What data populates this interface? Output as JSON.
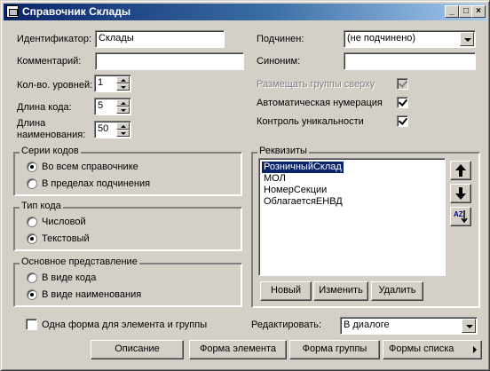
{
  "window": {
    "title": "Справочник Склады",
    "minimize": "_",
    "maximize": "□",
    "close": "×"
  },
  "left": {
    "id_label": "Идентификатор:",
    "id_value": "Склады",
    "comment_label": "Комментарий:",
    "comment_value": "",
    "levels_label": "Кол-во. уровней:",
    "levels_value": "1",
    "code_len_label": "Длина кода:",
    "code_len_value": "5",
    "name_len_label_1": "Длина",
    "name_len_label_2": "наименования:",
    "name_len_value": "50"
  },
  "right": {
    "parent_label": "Подчинен:",
    "parent_value": "(не подчинено)",
    "synonym_label": "Синоним:",
    "synonym_value": "",
    "groups_top_label": "Размещать группы сверху",
    "groups_top_checked": true,
    "auto_num_label": "Автоматическая нумерация",
    "auto_num_checked": true,
    "unique_label": "Контроль уникальности",
    "unique_checked": true
  },
  "series": {
    "title": "Серии кодов",
    "options": [
      "Во всем справочнике",
      "В пределах подчинения"
    ],
    "selected": 0
  },
  "code_type": {
    "title": "Тип кода",
    "options": [
      "Числовой",
      "Текстовый"
    ],
    "selected": 1
  },
  "presentation": {
    "title": "Основное представление",
    "options": [
      "В виде кода",
      "В виде наименования"
    ],
    "selected": 1
  },
  "attributes": {
    "title": "Реквизиты",
    "items": [
      "РозничныйСклад",
      "МОЛ",
      "НомерСекции",
      "ОблагаетсяЕНВД"
    ],
    "selected": 0,
    "new_label": "Новый",
    "edit_label": "Изменить",
    "delete_label": "Удалить",
    "sort_icon_text": "AZ"
  },
  "bottom": {
    "one_form_label": "Одна форма для элемента и группы",
    "one_form_checked": false,
    "edit_label": "Редактировать:",
    "edit_value": "В диалоге",
    "description_btn": "Описание",
    "element_form_btn": "Форма элемента",
    "group_form_btn": "Форма группы",
    "list_forms_btn": "Формы списка"
  }
}
